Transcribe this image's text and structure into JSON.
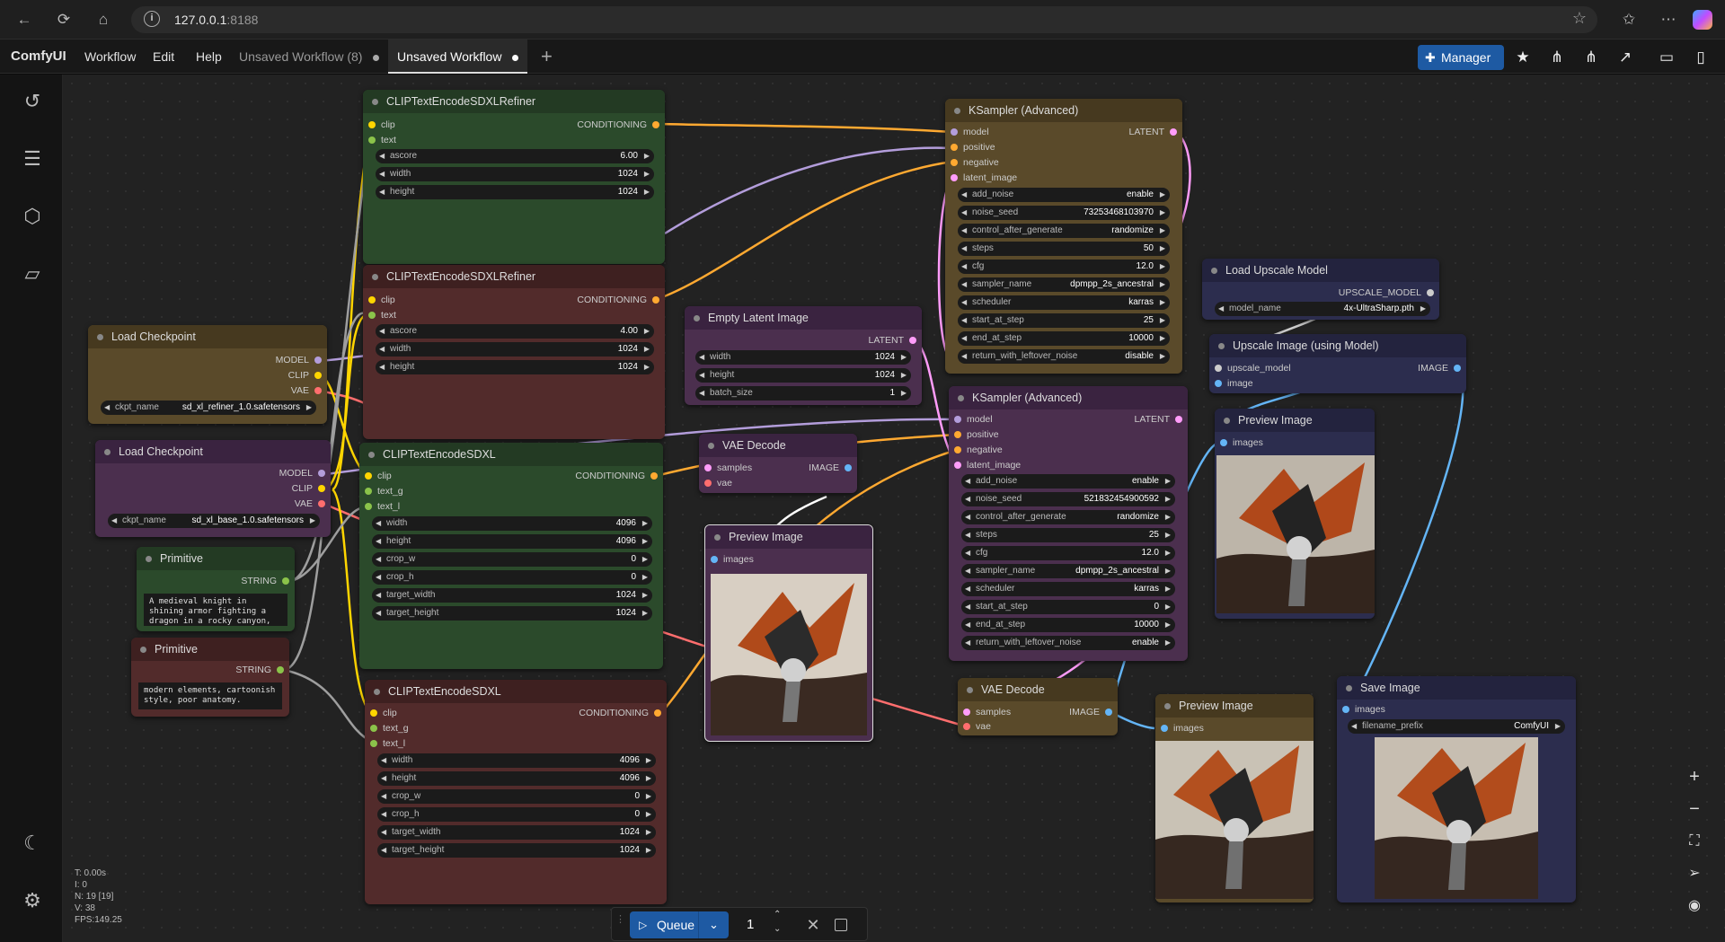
{
  "browser": {
    "url_host": "127.0.0.1",
    "url_port": ":8188"
  },
  "app": {
    "brand": "ComfyUI",
    "menus": [
      "Workflow",
      "Edit",
      "Help"
    ],
    "tabs": [
      {
        "label": "Unsaved Workflow (8)"
      },
      {
        "label": "Unsaved Workflow"
      }
    ],
    "manager": "Manager"
  },
  "stats": {
    "t": "T: 0.00s",
    "i": "I: 0",
    "n": "N: 19 [19]",
    "v": "V: 38",
    "fps": "FPS:149.25"
  },
  "queue": {
    "label": "Queue",
    "count": "1"
  },
  "nodes": {
    "clip_ref1": {
      "title": "CLIPTextEncodeSDXLRefiner",
      "in1": "clip",
      "in2": "text",
      "out": "CONDITIONING",
      "w1l": "ascore",
      "w1v": "6.00",
      "w2l": "width",
      "w2v": "1024",
      "w3l": "height",
      "w3v": "1024"
    },
    "clip_ref2": {
      "title": "CLIPTextEncodeSDXLRefiner",
      "in1": "clip",
      "in2": "text",
      "out": "CONDITIONING",
      "w1l": "ascore",
      "w1v": "4.00",
      "w2l": "width",
      "w2v": "1024",
      "w3l": "height",
      "w3v": "1024"
    },
    "load_ckpt1": {
      "title": "Load Checkpoint",
      "o1": "MODEL",
      "o2": "CLIP",
      "o3": "VAE",
      "wl": "ckpt_name",
      "wv": "sd_xl_refiner_1.0.safetensors"
    },
    "load_ckpt2": {
      "title": "Load Checkpoint",
      "o1": "MODEL",
      "o2": "CLIP",
      "o3": "VAE",
      "wl": "ckpt_name",
      "wv": "sd_xl_base_1.0.safetensors"
    },
    "prim1": {
      "title": "Primitive",
      "out": "STRING",
      "text": "A medieval knight in shining armor fighting a dragon in a rocky canyon, dynamic action"
    },
    "prim2": {
      "title": "Primitive",
      "out": "STRING",
      "text": "modern elements, cartoonish style, poor anatomy."
    },
    "clip_sdxl1": {
      "title": "CLIPTextEncodeSDXL",
      "in1": "clip",
      "in2": "text_g",
      "in3": "text_l",
      "out": "CONDITIONING",
      "w": [
        [
          "width",
          "4096"
        ],
        [
          "height",
          "4096"
        ],
        [
          "crop_w",
          "0"
        ],
        [
          "crop_h",
          "0"
        ],
        [
          "target_width",
          "1024"
        ],
        [
          "target_height",
          "1024"
        ]
      ]
    },
    "clip_sdxl2": {
      "title": "CLIPTextEncodeSDXL",
      "in1": "clip",
      "in2": "text_g",
      "in3": "text_l",
      "out": "CONDITIONING",
      "w": [
        [
          "width",
          "4096"
        ],
        [
          "height",
          "4096"
        ],
        [
          "crop_w",
          "0"
        ],
        [
          "crop_h",
          "0"
        ],
        [
          "target_width",
          "1024"
        ],
        [
          "target_height",
          "1024"
        ]
      ]
    },
    "empty_latent": {
      "title": "Empty Latent Image",
      "out": "LATENT",
      "w": [
        [
          "width",
          "1024"
        ],
        [
          "height",
          "1024"
        ],
        [
          "batch_size",
          "1"
        ]
      ]
    },
    "vae_dec1": {
      "title": "VAE Decode",
      "in1": "samples",
      "in2": "vae",
      "out": "IMAGE"
    },
    "preview1": {
      "title": "Preview Image",
      "in1": "images"
    },
    "ksampler1": {
      "title": "KSampler (Advanced)",
      "in": [
        "model",
        "positive",
        "negative",
        "latent_image"
      ],
      "out": "LATENT",
      "w": [
        [
          "add_noise",
          "enable"
        ],
        [
          "noise_seed",
          "73253468103970"
        ],
        [
          "control_after_generate",
          "randomize"
        ],
        [
          "steps",
          "50"
        ],
        [
          "cfg",
          "12.0"
        ],
        [
          "sampler_name",
          "dpmpp_2s_ancestral"
        ],
        [
          "scheduler",
          "karras"
        ],
        [
          "start_at_step",
          "25"
        ],
        [
          "end_at_step",
          "10000"
        ],
        [
          "return_with_leftover_noise",
          "disable"
        ]
      ]
    },
    "ksampler2": {
      "title": "KSampler (Advanced)",
      "in": [
        "model",
        "positive",
        "negative",
        "latent_image"
      ],
      "out": "LATENT",
      "w": [
        [
          "add_noise",
          "enable"
        ],
        [
          "noise_seed",
          "521832454900592"
        ],
        [
          "control_after_generate",
          "randomize"
        ],
        [
          "steps",
          "25"
        ],
        [
          "cfg",
          "12.0"
        ],
        [
          "sampler_name",
          "dpmpp_2s_ancestral"
        ],
        [
          "scheduler",
          "karras"
        ],
        [
          "start_at_step",
          "0"
        ],
        [
          "end_at_step",
          "10000"
        ],
        [
          "return_with_leftover_noise",
          "enable"
        ]
      ]
    },
    "vae_dec2": {
      "title": "VAE Decode",
      "in1": "samples",
      "in2": "vae",
      "out": "IMAGE"
    },
    "preview2": {
      "title": "Preview Image",
      "in1": "images"
    },
    "load_upscale": {
      "title": "Load Upscale Model",
      "out": "UPSCALE_MODEL",
      "wl": "model_name",
      "wv": "4x-UltraSharp.pth"
    },
    "upscale": {
      "title": "Upscale Image (using Model)",
      "in1": "upscale_model",
      "in2": "image",
      "out": "IMAGE"
    },
    "preview3": {
      "title": "Preview Image",
      "in1": "images"
    },
    "save": {
      "title": "Save Image",
      "in1": "images",
      "wl": "filename_prefix",
      "wv": "ComfyUI"
    }
  },
  "colors": {
    "clip": "#ffd500",
    "model": "#b39ddb",
    "vae": "#ff6e6e",
    "cond": "#ffa931",
    "latent": "#ff9cf9",
    "image": "#64b5f6",
    "string": "#8bc34a"
  }
}
